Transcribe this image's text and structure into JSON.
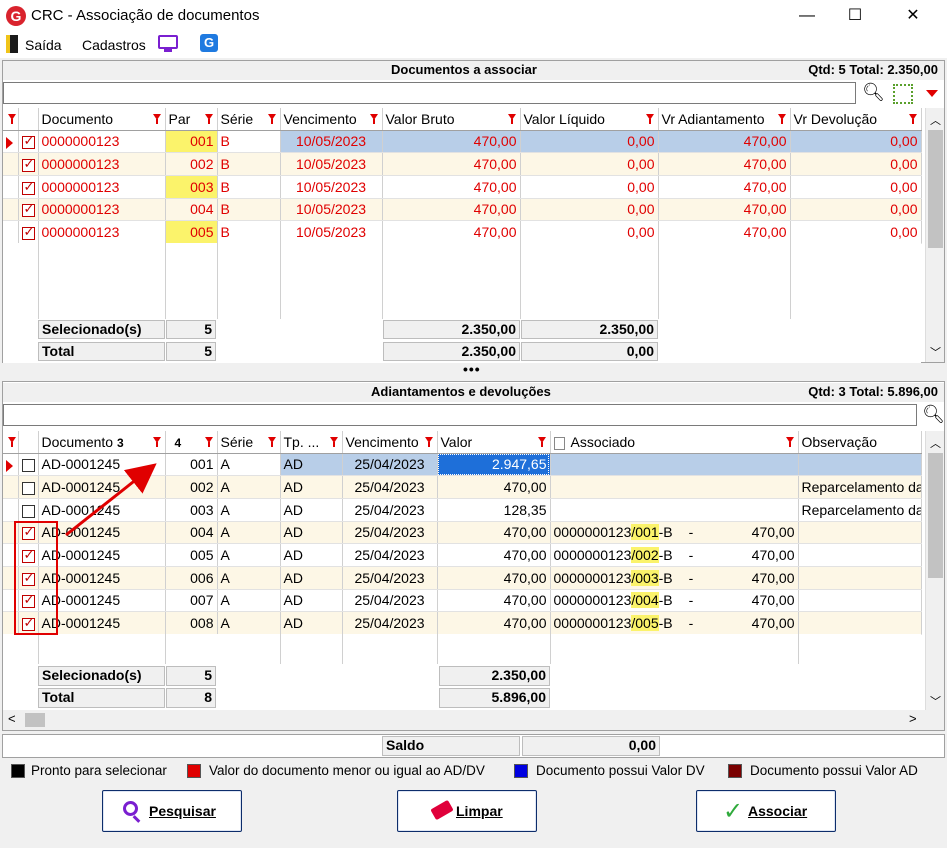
{
  "window": {
    "title": "CRC - Associação de documentos",
    "minimize": "—",
    "maximize": "☐",
    "close": "✕",
    "logo": "G"
  },
  "menu": {
    "exit": "Saída",
    "cadastros": "Cadastros",
    "g_icon": "G"
  },
  "top_panel": {
    "title": "Documentos a associar",
    "summary": "Qtd: 5 Total: 2.350,00",
    "search_value": "",
    "columns": [
      "Documento",
      "Par",
      "Série",
      "Vencimento",
      "Valor Bruto",
      "Valor Líquido",
      "Vr Adiantamento",
      "Vr Devolução"
    ],
    "rows": [
      {
        "documento": "0000000123",
        "par": "001",
        "serie": "B",
        "vencimento": "10/05/2023",
        "bruto": "470,00",
        "liquido": "0,00",
        "adiant": "470,00",
        "devol": "0,00"
      },
      {
        "documento": "0000000123",
        "par": "002",
        "serie": "B",
        "vencimento": "10/05/2023",
        "bruto": "470,00",
        "liquido": "0,00",
        "adiant": "470,00",
        "devol": "0,00"
      },
      {
        "documento": "0000000123",
        "par": "003",
        "serie": "B",
        "vencimento": "10/05/2023",
        "bruto": "470,00",
        "liquido": "0,00",
        "adiant": "470,00",
        "devol": "0,00"
      },
      {
        "documento": "0000000123",
        "par": "004",
        "serie": "B",
        "vencimento": "10/05/2023",
        "bruto": "470,00",
        "liquido": "0,00",
        "adiant": "470,00",
        "devol": "0,00"
      },
      {
        "documento": "0000000123",
        "par": "005",
        "serie": "B",
        "vencimento": "10/05/2023",
        "bruto": "470,00",
        "liquido": "0,00",
        "adiant": "470,00",
        "devol": "0,00"
      }
    ],
    "selected_label": "Selecionado(s)",
    "selected_count": "5",
    "selected_bruto": "2.350,00",
    "selected_liquido": "2.350,00",
    "total_label": "Total",
    "total_count": "5",
    "total_bruto": "2.350,00",
    "total_liquido": "0,00"
  },
  "splitter": "•••",
  "bottom_panel": {
    "title": "Adiantamentos e devoluções",
    "summary": "Qtd: 3 Total: 5.896,00",
    "search_value": "",
    "columns": [
      "Documento",
      "3",
      "4",
      "Série",
      "Tp. ...",
      "Vencimento",
      "Valor",
      "Associado",
      "Observação"
    ],
    "rows": [
      {
        "checked": false,
        "documento": "AD-0001245",
        "num": "001",
        "serie": "A",
        "tp": "AD",
        "vencimento": "25/04/2023",
        "valor": "2.947,65",
        "assoc_doc": "",
        "assoc_par": "",
        "assoc_suffix": "",
        "assoc_dash": "",
        "assoc_val": "",
        "obs": ""
      },
      {
        "checked": false,
        "documento": "AD-0001245",
        "num": "002",
        "serie": "A",
        "tp": "AD",
        "vencimento": "25/04/2023",
        "valor": "470,00",
        "assoc_doc": "",
        "assoc_par": "",
        "assoc_suffix": "",
        "assoc_dash": "",
        "assoc_val": "",
        "obs": "Reparcelamento da"
      },
      {
        "checked": false,
        "documento": "AD-0001245",
        "num": "003",
        "serie": "A",
        "tp": "AD",
        "vencimento": "25/04/2023",
        "valor": "128,35",
        "assoc_doc": "",
        "assoc_par": "",
        "assoc_suffix": "",
        "assoc_dash": "",
        "assoc_val": "",
        "obs": "Reparcelamento da"
      },
      {
        "checked": true,
        "documento": "AD-0001245",
        "num": "004",
        "serie": "A",
        "tp": "AD",
        "vencimento": "25/04/2023",
        "valor": "470,00",
        "assoc_doc": "0000000123",
        "assoc_par": "/001",
        "assoc_suffix": "-B",
        "assoc_dash": "-",
        "assoc_val": "470,00",
        "obs": ""
      },
      {
        "checked": true,
        "documento": "AD-0001245",
        "num": "005",
        "serie": "A",
        "tp": "AD",
        "vencimento": "25/04/2023",
        "valor": "470,00",
        "assoc_doc": "0000000123",
        "assoc_par": "/002",
        "assoc_suffix": "-B",
        "assoc_dash": "-",
        "assoc_val": "470,00",
        "obs": ""
      },
      {
        "checked": true,
        "documento": "AD-0001245",
        "num": "006",
        "serie": "A",
        "tp": "AD",
        "vencimento": "25/04/2023",
        "valor": "470,00",
        "assoc_doc": "0000000123",
        "assoc_par": "/003",
        "assoc_suffix": "-B",
        "assoc_dash": "-",
        "assoc_val": "470,00",
        "obs": ""
      },
      {
        "checked": true,
        "documento": "AD-0001245",
        "num": "007",
        "serie": "A",
        "tp": "AD",
        "vencimento": "25/04/2023",
        "valor": "470,00",
        "assoc_doc": "0000000123",
        "assoc_par": "/004",
        "assoc_suffix": "-B",
        "assoc_dash": "-",
        "assoc_val": "470,00",
        "obs": ""
      },
      {
        "checked": true,
        "documento": "AD-0001245",
        "num": "008",
        "serie": "A",
        "tp": "AD",
        "vencimento": "25/04/2023",
        "valor": "470,00",
        "assoc_doc": "0000000123",
        "assoc_par": "/005",
        "assoc_suffix": "-B",
        "assoc_dash": "-",
        "assoc_val": "470,00",
        "obs": ""
      }
    ],
    "selected_label": "Selecionado(s)",
    "selected_count": "5",
    "selected_valor": "2.350,00",
    "total_label": "Total",
    "total_count": "8",
    "total_valor": "5.896,00"
  },
  "saldo": {
    "label": "Saldo",
    "value": "0,00"
  },
  "legend": [
    {
      "color": "#000000",
      "text": "Pronto para selecionar"
    },
    {
      "color": "#e00000",
      "text": "Valor do documento menor ou igual ao AD/DV"
    },
    {
      "color": "#0000e0",
      "text": "Documento possui Valor DV"
    },
    {
      "color": "#7a0000",
      "text": "Documento possui Valor AD"
    }
  ],
  "buttons": {
    "search": "Pesquisar",
    "clear": "Limpar",
    "associate": "Associar"
  },
  "colors": {
    "highlight": "#fbf36b",
    "annotation": "#e00000",
    "selection": "#b8cee8"
  }
}
